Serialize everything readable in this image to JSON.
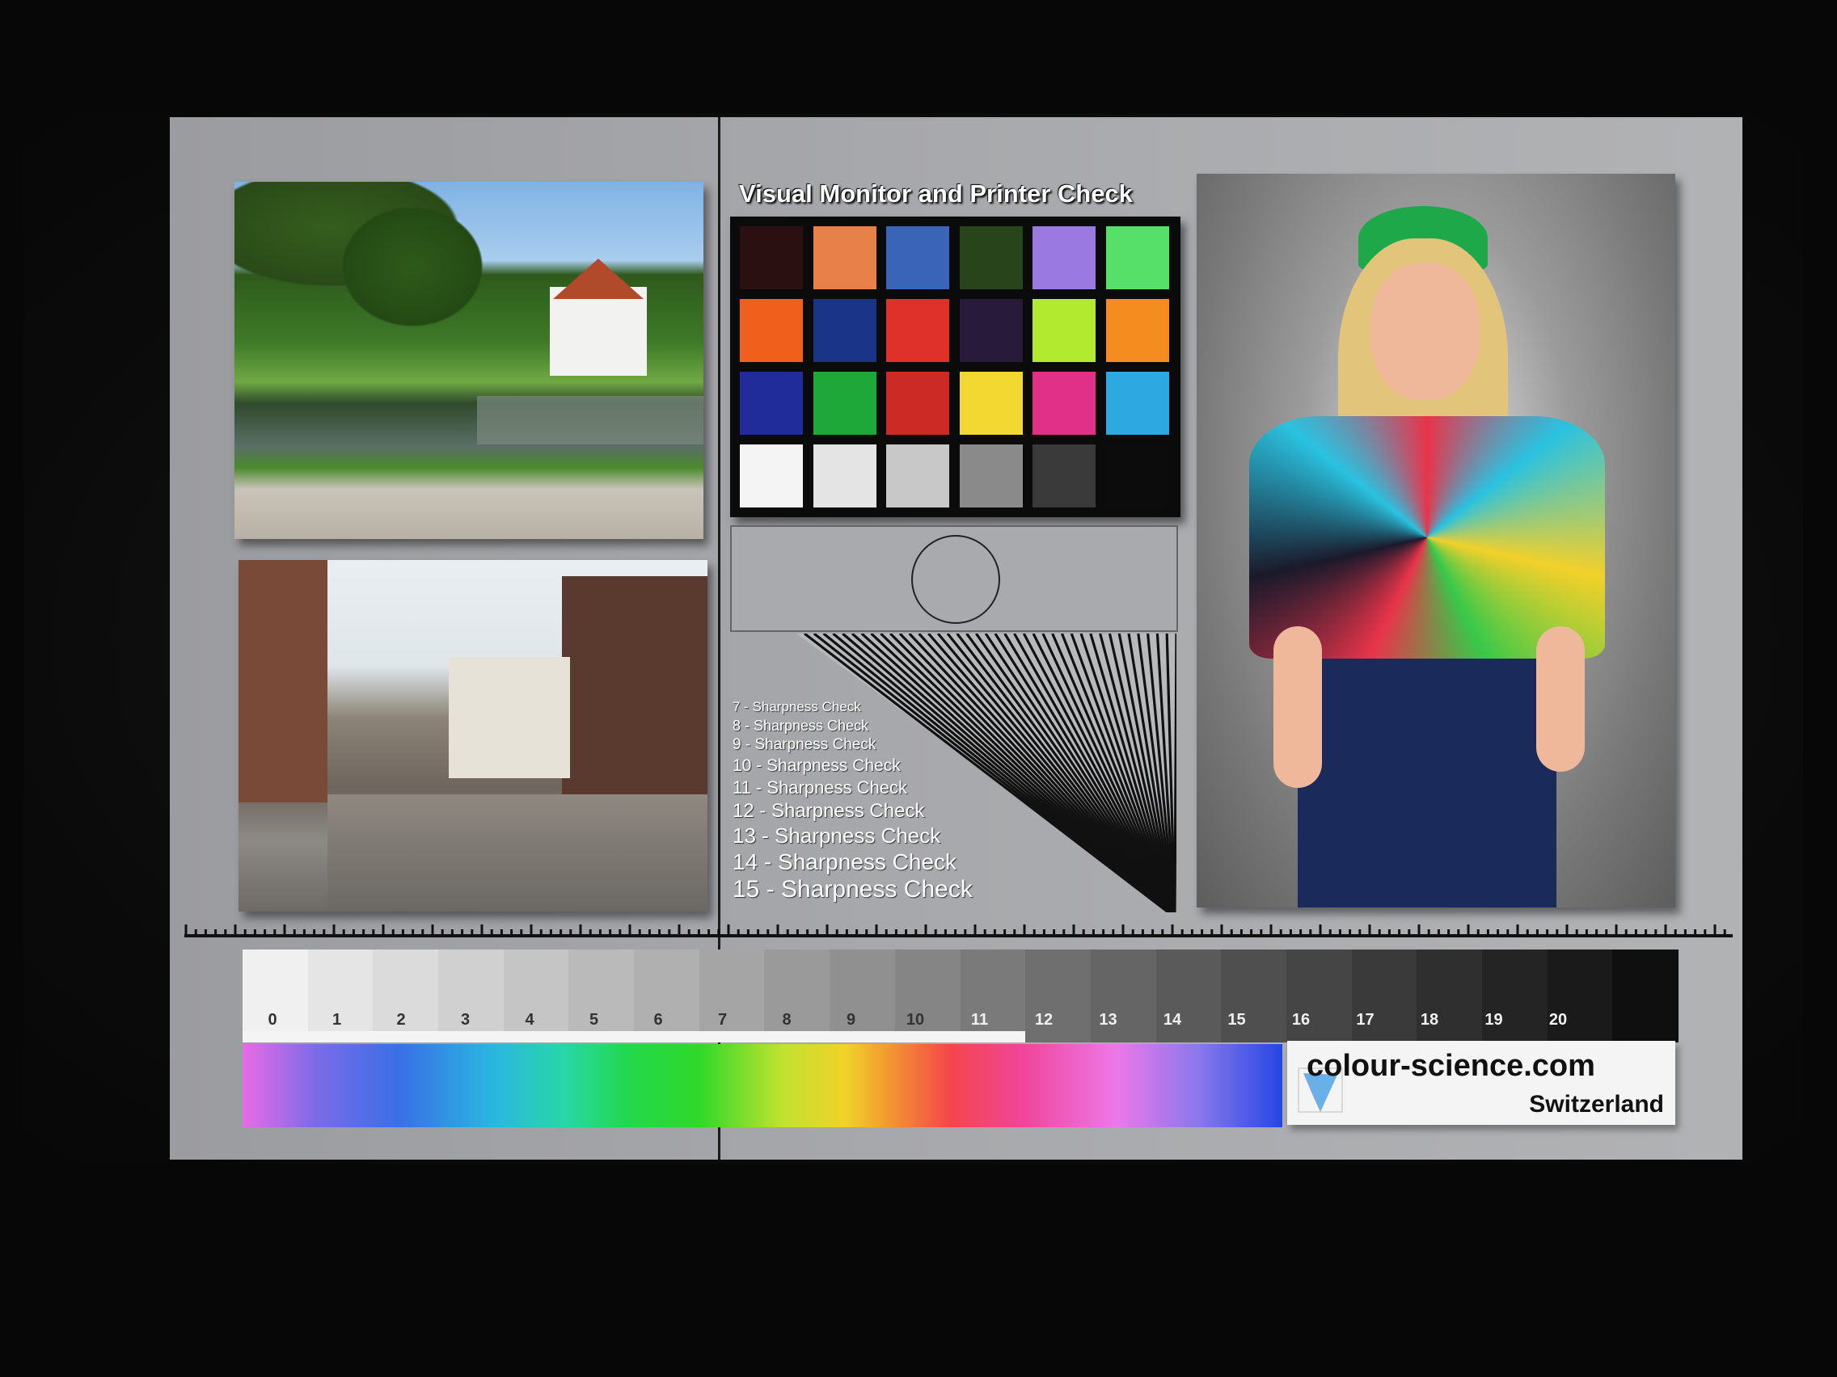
{
  "chart_title": "Visual Monitor and Printer Check",
  "checker_colors": [
    "#2a1010",
    "#e8804a",
    "#3a64b8",
    "#28441a",
    "#9a7ae0",
    "#56e06a",
    "#f0601c",
    "#1a3488",
    "#e0302a",
    "#281a3a",
    "#b2ea30",
    "#f48c20",
    "#202c9a",
    "#1ea83a",
    "#cc2a24",
    "#f2d830",
    "#e03088",
    "#2ea8e0",
    "#f4f4f4",
    "#e4e4e4",
    "#c8c8c8",
    "#8a8a8a",
    "#3a3a3a",
    "#0c0c0c"
  ],
  "sharpness_lines": [
    {
      "label": "7 - Sharpness Check",
      "size": 17
    },
    {
      "label": "8 - Sharpness Check",
      "size": 18
    },
    {
      "label": "9 - Sharpness Check",
      "size": 19
    },
    {
      "label": "10 - Sharpness Check",
      "size": 21
    },
    {
      "label": "11 - Sharpness Check",
      "size": 22
    },
    {
      "label": "12 - Sharpness Check",
      "size": 24
    },
    {
      "label": "13 - Sharpness Check",
      "size": 26
    },
    {
      "label": "14 - Sharpness Check",
      "size": 28
    },
    {
      "label": "15 - Sharpness Check",
      "size": 30
    }
  ],
  "greyscale_labels": [
    "0",
    "1",
    "2",
    "3",
    "4",
    "5",
    "6",
    "7",
    "8",
    "9",
    "10",
    "11",
    "12",
    "13",
    "14",
    "15",
    "16",
    "17",
    "18",
    "19",
    "20"
  ],
  "logo": {
    "text": "colour-science.com",
    "sub": "Switzerland"
  }
}
